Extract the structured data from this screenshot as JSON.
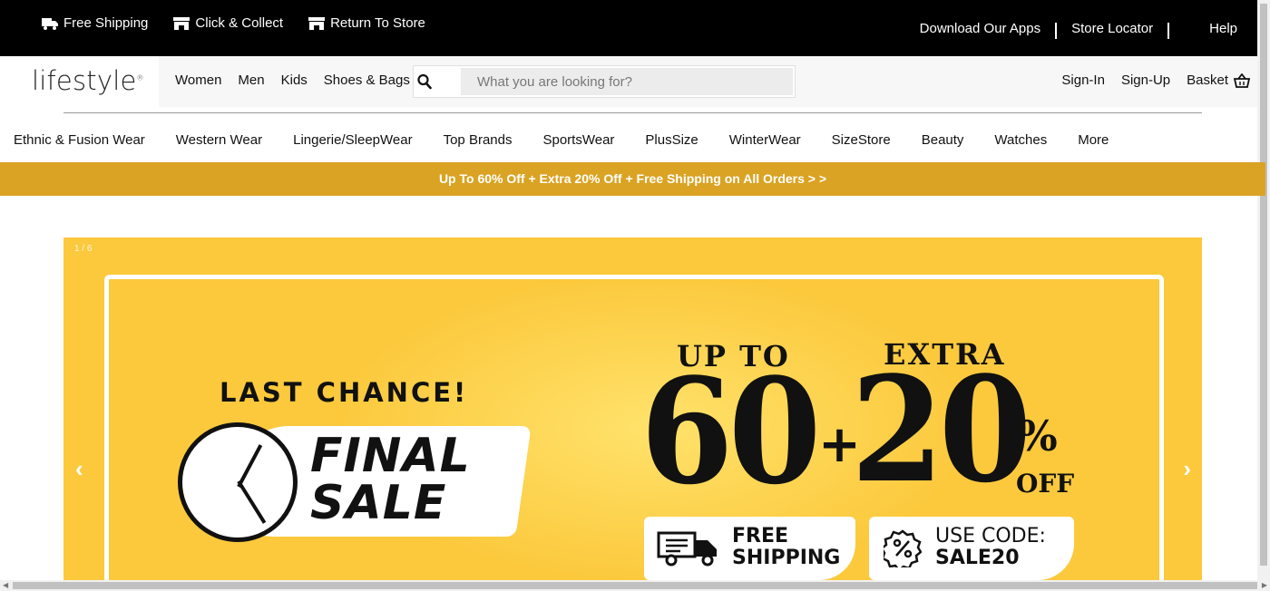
{
  "topbar": {
    "left_items": [
      {
        "label": "Free Shipping",
        "icon": "truck-icon"
      },
      {
        "label": "Click & Collect",
        "icon": "store-icon"
      },
      {
        "label": "Return To Store",
        "icon": "store-icon"
      }
    ],
    "download_apps": "Download Our Apps",
    "store_locator": "Store Locator",
    "help": "Help"
  },
  "header": {
    "logo": "lifestyle",
    "nav": [
      "Women",
      "Men",
      "Kids",
      "Shoes & Bags"
    ],
    "search_placeholder": "What you are looking for?",
    "sign_in": "Sign-In",
    "sign_up": "Sign-Up",
    "basket": "Basket"
  },
  "categories": [
    "Ethnic & Fusion Wear",
    "Western Wear",
    "Lingerie/SleepWear",
    "Top Brands",
    "SportsWear",
    "PlusSize",
    "WinterWear",
    "SizeStore",
    "Beauty",
    "Watches",
    "More"
  ],
  "promo_strip": "Up To 60% Off + Extra 20% Off + Free Shipping on All Orders > >",
  "banner": {
    "slide_counter": "1 / 6",
    "last_chance": "LAST CHANCE!",
    "final_line1": "FINAL",
    "final_line2": "SALE",
    "up_to": "UP TO",
    "extra": "EXTRA",
    "big_left": "60",
    "plus": "+",
    "big_right": "20",
    "percent": "%",
    "off": "OFF",
    "shipping_line1": "FREE",
    "shipping_line2": "SHIPPING",
    "code_line1": "USE CODE:",
    "code_line2": "SALE20",
    "prev_arrow": "‹",
    "next_arrow": "›"
  },
  "colors": {
    "topbar_bg": "#000000",
    "promo_bg": "#daa323",
    "banner_bg": "#fcc93d"
  }
}
